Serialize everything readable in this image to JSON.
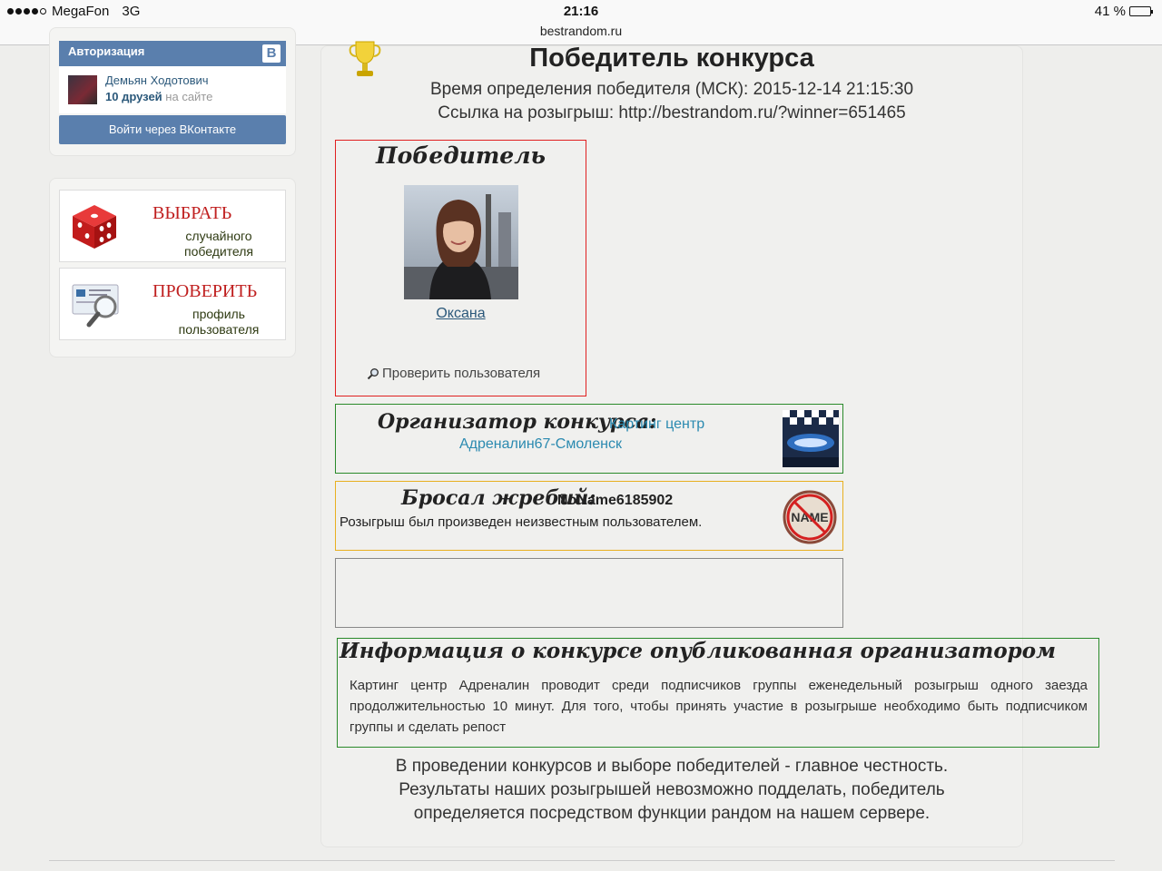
{
  "statusbar": {
    "carrier": "MegaFon",
    "network": "3G",
    "time": "21:16",
    "url": "bestrandom.ru",
    "battery": "41 %",
    "battery_level": 0.41
  },
  "sidebar": {
    "auth": {
      "title": "Авторизация",
      "badge": "В",
      "user_name": "Демьян Ходотович",
      "friends_count": "10 друзей",
      "friends_suffix": "на сайте",
      "login_button": "Войти через ВКонтакте"
    },
    "tools": [
      {
        "title": "ВЫБРАТЬ",
        "subtitle_line1": "случайного",
        "subtitle_line2": "победителя"
      },
      {
        "title": "ПРОВЕРИТЬ",
        "subtitle_line1": "профиль",
        "subtitle_line2": "пользователя"
      }
    ]
  },
  "main": {
    "title": "Победитель конкурса",
    "time_line": "Время определения победителя (МСК): 2015-12-14 21:15:30",
    "link_line": "Ссылка на розыгрыш: http://bestrandom.ru/?winner=651465",
    "winner": {
      "heading": "Победитель",
      "name": "Оксана",
      "check_link": "Проверить пользователя"
    },
    "organizer": {
      "label": "Организатор конкурса:",
      "name_line1": "Картинг центр",
      "name_line2": "Адреналин67-Смоленск"
    },
    "draw": {
      "label": "Бросал жребий:",
      "user": "NoName6185902",
      "note": "Розыгрыш был произведен неизвестным пользователем.",
      "icon_text": "NAME"
    },
    "info": {
      "heading": "Информация о конкурсе опубликованная организатором",
      "text": "Картинг центр Адреналин проводит среди подписчиков группы еженедельный розыгрыш одного заезда продолжительностью 10 минут. Для того, чтобы принять участие в розыгрыше необходимо быть подписчиком группы и сделать репост"
    },
    "closing_line1": "В проведении конкурсов и выборе победителей - главное честность.",
    "closing_line2": "Результаты наших розыгрышей невозможно подделать, победитель",
    "closing_line3": "определяется посредством функции рандом на нашем сервере."
  },
  "colors": {
    "vk_blue": "#5a7fad",
    "winner_border": "#e02020",
    "organizer_border": "#2a8a2a",
    "draw_border": "#e8b020",
    "link": "#2b8ab0"
  }
}
